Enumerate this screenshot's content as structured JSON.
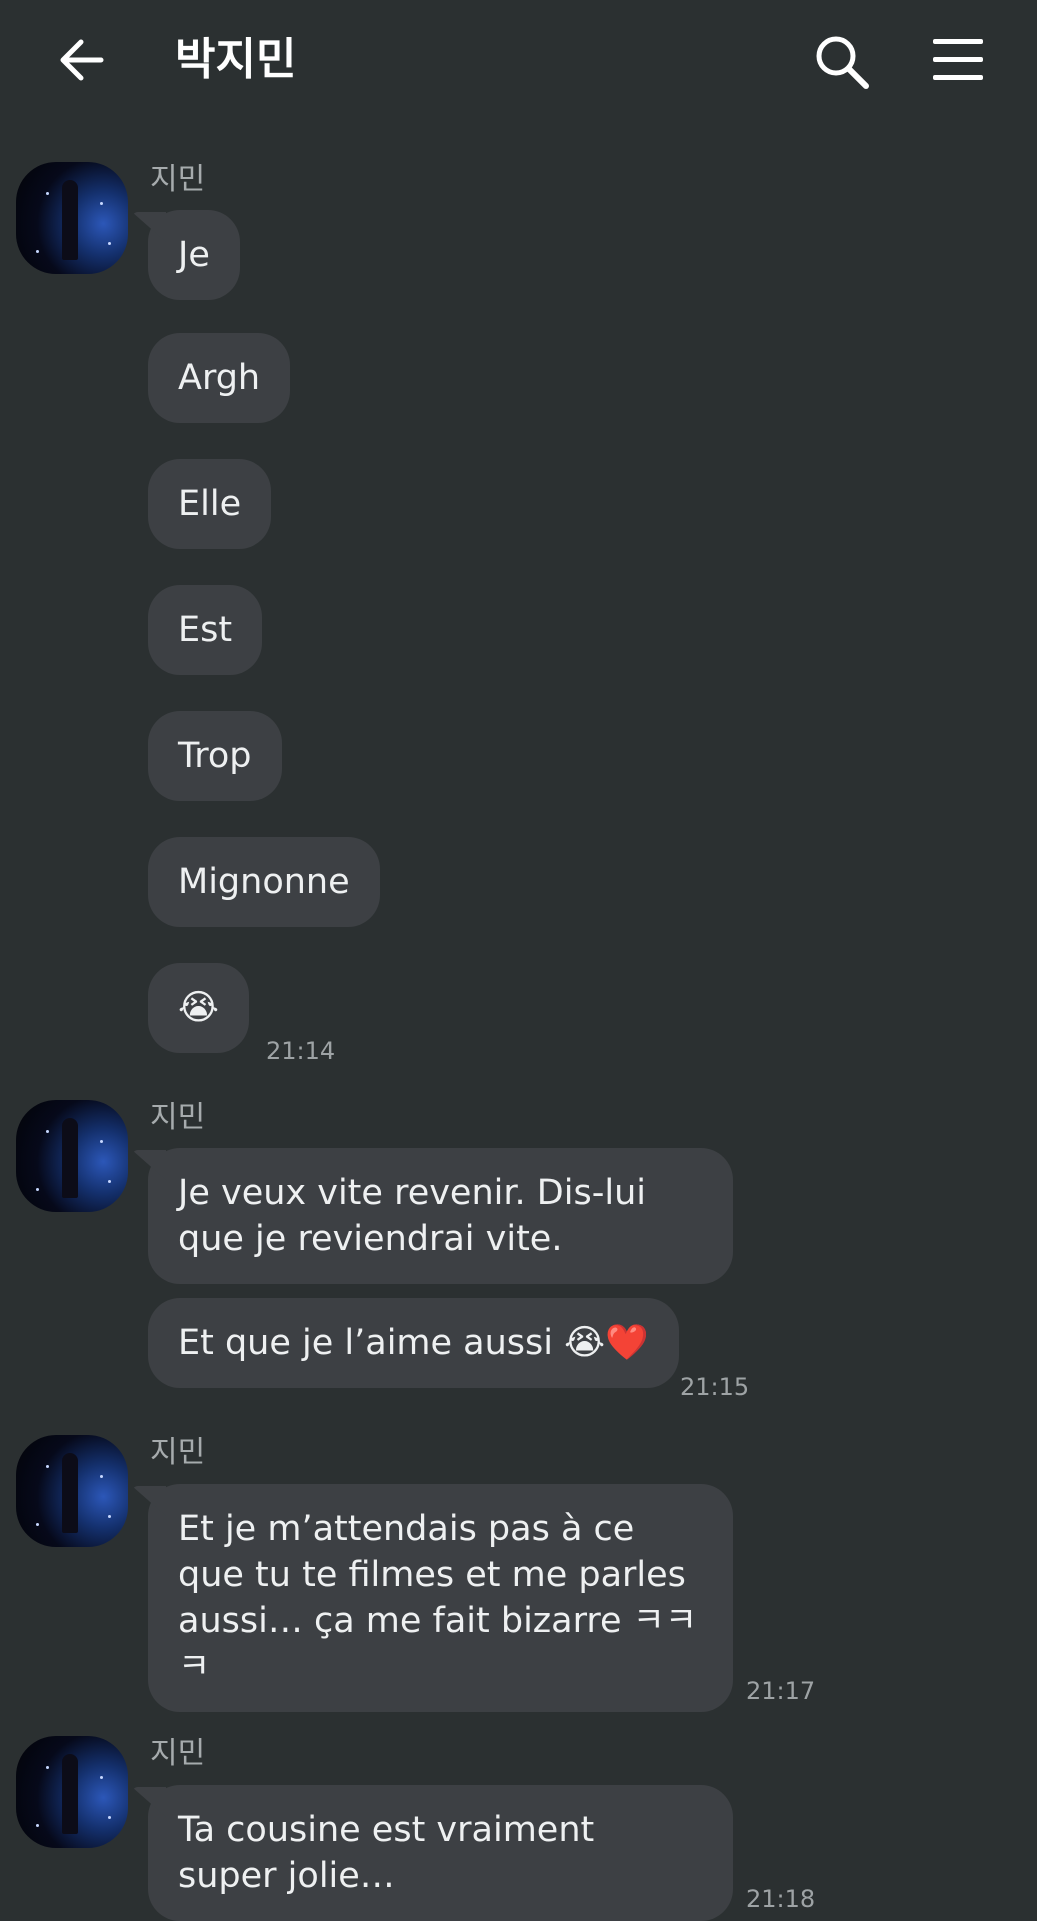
{
  "header": {
    "title": "박지민",
    "back_icon": "arrow-left-icon",
    "search_icon": "search-icon",
    "menu_icon": "hamburger-menu-icon"
  },
  "messages": {
    "g1": {
      "sender": "지민",
      "bubbles": [
        "Je",
        "Argh",
        "Elle",
        "Est",
        "Trop",
        "Mignonne",
        "😭"
      ],
      "time": "21:14"
    },
    "g2": {
      "sender": "지민",
      "bubbles": [
        "Je veux vite revenir. Dis-lui que je reviendrai vite.",
        "Et que je l’aime aussi 😭❤️"
      ],
      "time": "21:15"
    },
    "g3": {
      "sender": "지민",
      "bubbles": [
        "Et je m’attendais pas à ce que tu te filmes et me parles aussi… ça me fait bizarre ㅋㅋㅋ"
      ],
      "time": "21:17"
    },
    "g4": {
      "sender": "지민",
      "bubbles": [
        "Ta cousine est vraiment super jolie…"
      ],
      "time": "21:18"
    }
  },
  "colors": {
    "background": "#2b3031",
    "bubble": "#3d4044",
    "text": "#eef0f1",
    "meta": "#9ea3a5"
  }
}
